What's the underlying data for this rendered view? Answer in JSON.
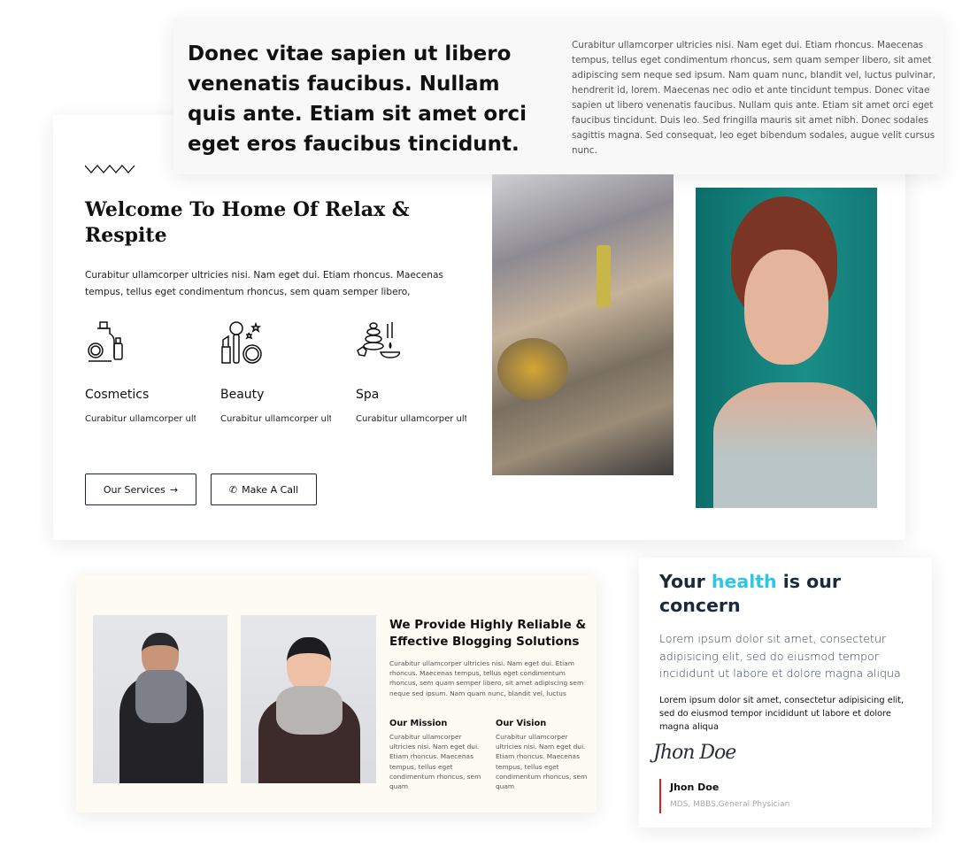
{
  "top_card": {
    "heading": "Donec vitae sapien ut libero venenatis faucibus. Nullam quis ante. Etiam sit amet orci eget eros faucibus tincidunt.",
    "lines": [
      "Curabitur ullamcorper ultricies nisi. Nam eget dui. Etiam rhoncus. Maecenas",
      "tempus, tellus eget condimentum rhoncus, sem quam semper libero, sit amet",
      "adipiscing sem neque sed ipsum. Nam quam nunc, blandit vel, luctus pulvinar,",
      "hendrerit id, lorem. Maecenas nec odio et ante tincidunt tempus. Donec vitae",
      "sapien ut libero venenatis faucibus. Nullam quis ante. Etiam sit amet orci eget eros",
      "faucibus tincidunt. Duis leo. Sed fringilla mauris sit amet nibh. Donec sodales",
      "sagittis magna. Sed consequat, leo eget bibendum sodales, augue velit cursus",
      "nunc."
    ]
  },
  "main_card": {
    "heading": "Welcome To Home Of Relax & Respite",
    "intro": "Curabitur ullamcorper ultricies nisi. Nam eget dui. Etiam rhoncus. Maecenas tempus, tellus eget condimentum rhoncus, sem quam semper libero,",
    "services": [
      {
        "icon": "cosmetics-icon",
        "title": "Cosmetics",
        "desc": "Curabitur ullamcorper ultricies nisi. Nam eget"
      },
      {
        "icon": "beauty-icon",
        "title": "Beauty",
        "desc": "Curabitur ullamcorper ultricies nisi. Nam eget"
      },
      {
        "icon": "spa-icon",
        "title": "Spa",
        "desc": "Curabitur ullamcorper ultricies nisi. Nam ege"
      }
    ],
    "buttons": {
      "services": "Our Services",
      "call": "Make A Call"
    }
  },
  "blog_card": {
    "heading": "We Provide Highly Reliable & Effective Blogging Solutions",
    "text": "Curabitur ullamcorper ultricies nisi. Nam eget dui. Etiam rhoncus. Maecenas tempus, tellus eget condimentum rhoncus, sem quam semper libero, sit amet adipiscing sem neque sed ipsum. Nam quam nunc, blandit vel, luctus",
    "mission": {
      "title": "Our Mission",
      "text": "Curabitur ullamcorper ultricies nisi. Nam eget dui. Etiam rhoncus. Maecenas tempus, tellus eget condimentum rhoncus, sem quam"
    },
    "vision": {
      "title": "Our Vision",
      "text": "Curabitur ullamcorper ultricies nisi. Nam eget dui. Etiam rhoncus. Maecenas tempus, tellus eget condimentum rhoncus, sem quam"
    }
  },
  "health_card": {
    "h1": "Your ",
    "h_accent": "health",
    "h2": " is our concern",
    "lead": "Lorem ipsum dolor sit amet, consectetur adipisicing elit, sed do eiusmod tempor incididunt ut labore et dolore magna aliqua",
    "body": "Lorem ipsum dolor sit amet, consectetur adipisicing elit, sed do eiusmod tempor incididunt ut labore et dolore magna aliqua",
    "signature": "Jhon Doe",
    "name": "Jhon Doe",
    "role": "MDS, MBBS,General Physician"
  },
  "colors": {
    "accent": "#2cc6e6",
    "navy": "#1b2a3a",
    "red_bar": "#e41b1b"
  }
}
